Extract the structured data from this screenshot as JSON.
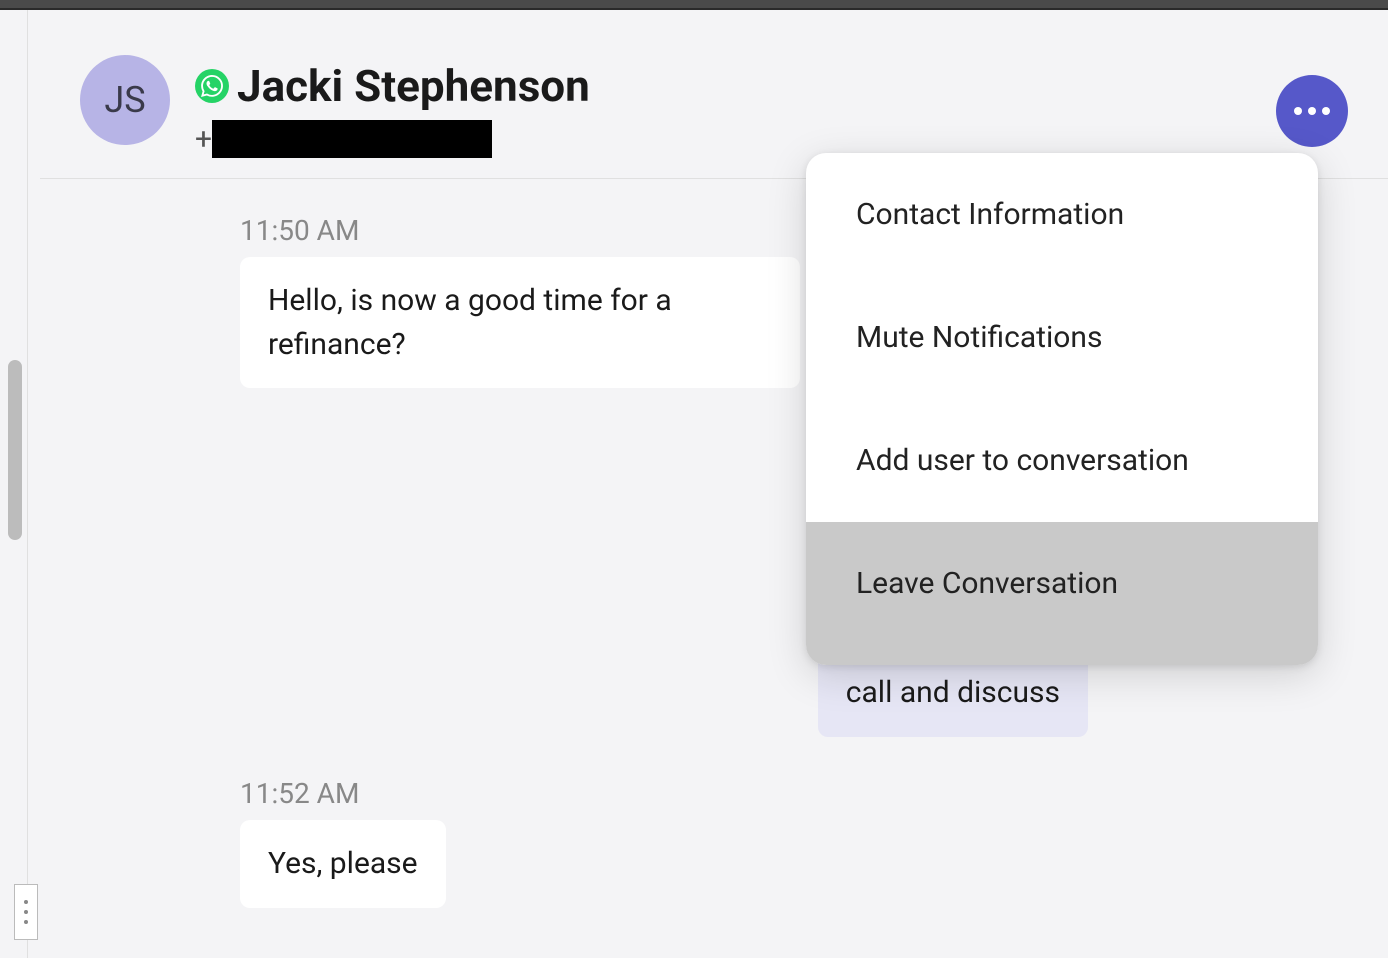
{
  "header": {
    "avatar_initials": "JS",
    "contact_name": "Jacki Stephenson",
    "phone_prefix": "+"
  },
  "messages": [
    {
      "timestamp": "11:50 AM",
      "direction": "incoming",
      "text": "Hello, is now a good time for a refinance?"
    },
    {
      "direction": "outgoing",
      "text": "Yes! Indeed, a l\nrefinance right \ncurrent interest\ncall and discuss"
    },
    {
      "timestamp": "11:52 AM",
      "direction": "incoming",
      "text": "Yes, please"
    }
  ],
  "menu": {
    "items": [
      "Contact Information",
      "Mute Notifications",
      "Add user to conversation",
      "Leave Conversation"
    ]
  }
}
